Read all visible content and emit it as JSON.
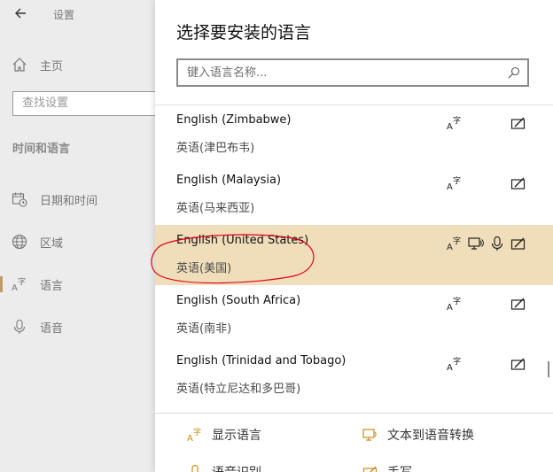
{
  "settings": {
    "title": "设置",
    "home": "主页",
    "search_placeholder": "查找设置",
    "section": "时间和语言",
    "nav": [
      {
        "label": "日期和时间",
        "icon": "calendar-clock-icon"
      },
      {
        "label": "区域",
        "icon": "globe-icon"
      },
      {
        "label": "语言",
        "icon": "language-icon",
        "selected": true
      },
      {
        "label": "语音",
        "icon": "microphone-icon"
      }
    ]
  },
  "flyout": {
    "title": "选择要安装的语言",
    "search_placeholder": "键入语言名称...",
    "languages": [
      {
        "name": "English (Zimbabwe)",
        "native": "英语(津巴布韦)",
        "features": [
          "display-language-icon",
          "handwriting-icon"
        ]
      },
      {
        "name": "English (Malaysia)",
        "native": "英语(马来西亚)",
        "features": [
          "display-language-icon",
          "handwriting-icon"
        ]
      },
      {
        "name": "English (United States)",
        "native": "英语(美国)",
        "selected": true,
        "features": [
          "display-language-icon",
          "text-to-speech-icon",
          "speech-recognition-icon",
          "handwriting-icon"
        ]
      },
      {
        "name": "English (South Africa)",
        "native": "英语(南非)",
        "features": [
          "display-language-icon",
          "handwriting-icon"
        ]
      },
      {
        "name": "English (Trinidad and Tobago)",
        "native": "英语(特立尼达和多巴哥)",
        "features": [
          "display-language-icon",
          "handwriting-icon"
        ]
      }
    ],
    "legend": {
      "display_language": "显示语言",
      "text_to_speech": "文本到语音转换",
      "speech_recognition": "语音识别",
      "handwriting": "手写"
    }
  },
  "colors": {
    "selected_row": "#f0deba",
    "accent": "#bd9b6a",
    "annotation": "#e0001a"
  }
}
